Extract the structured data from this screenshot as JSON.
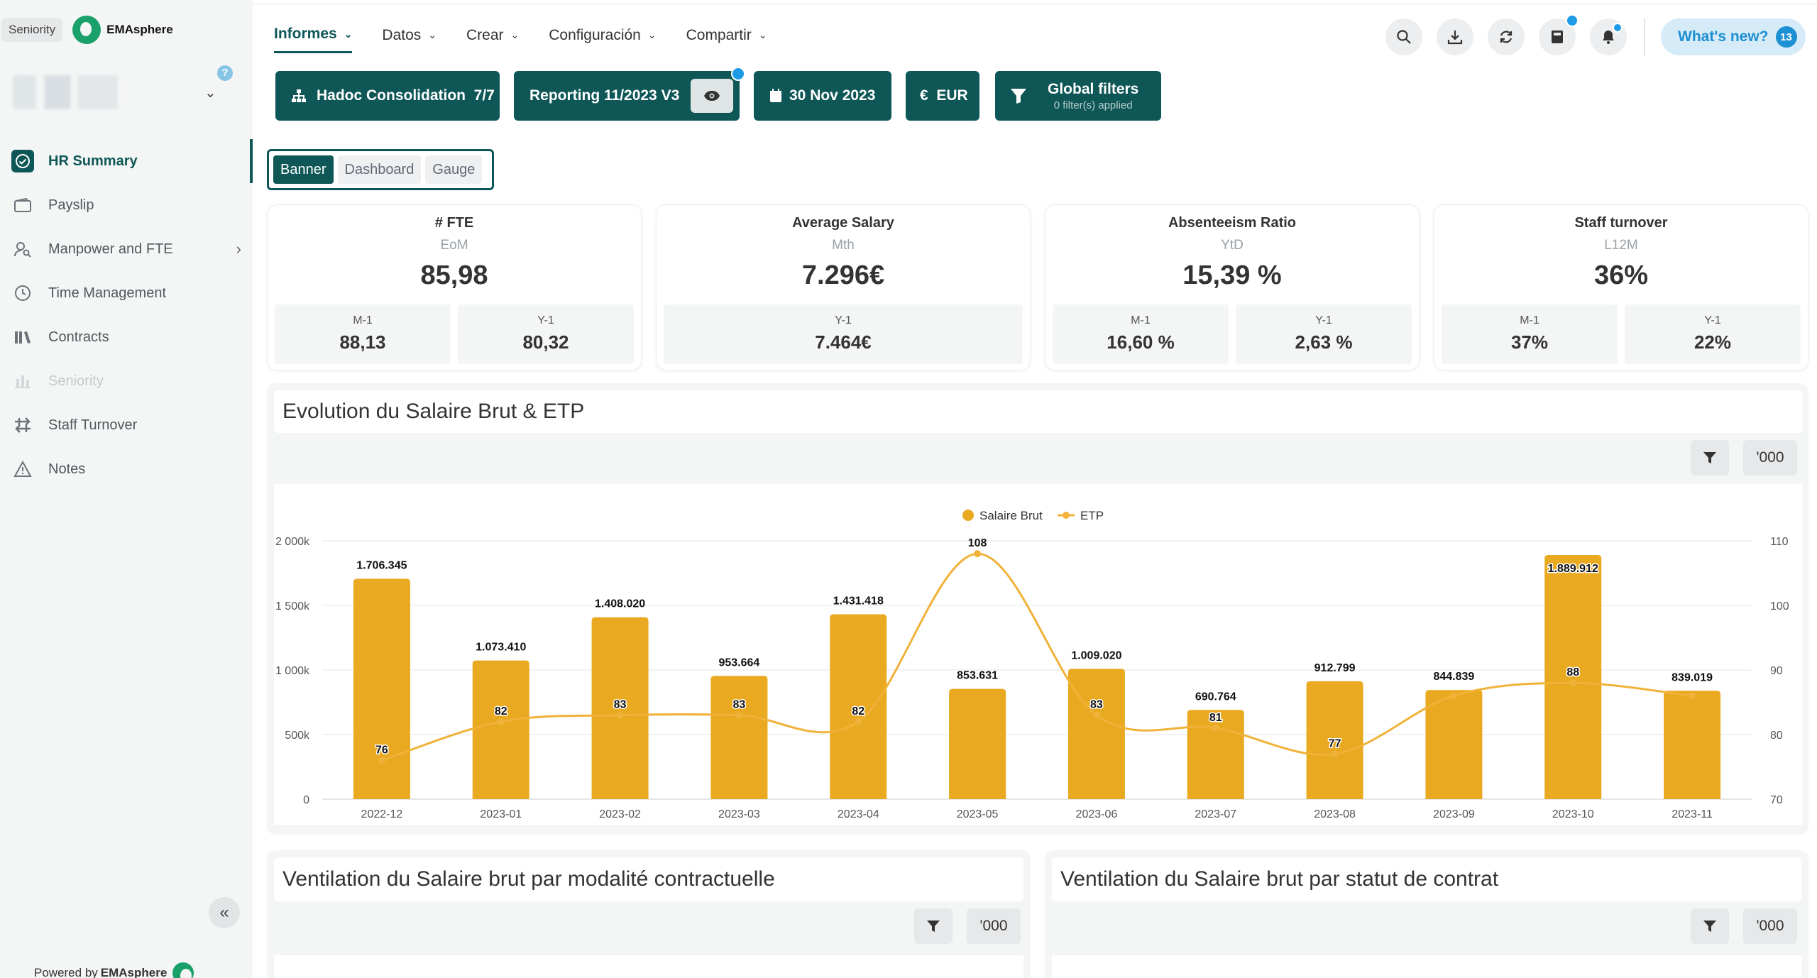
{
  "app": {
    "seniority_tag": "Seniority",
    "logo_text": "EMAsphere",
    "help": "?",
    "powered_prefix": "Powered by",
    "powered_brand": "EMAsphere"
  },
  "sidebar": {
    "items": [
      {
        "label": "HR Summary",
        "icon": "check-circle-icon",
        "active": true
      },
      {
        "label": "Payslip",
        "icon": "wallet-icon"
      },
      {
        "label": "Manpower and FTE",
        "icon": "person-search-icon",
        "has_arrow": true
      },
      {
        "label": "Time Management",
        "icon": "clock-icon"
      },
      {
        "label": "Contracts",
        "icon": "books-icon"
      },
      {
        "label": "Seniority",
        "icon": "bars-icon",
        "disabled": true
      },
      {
        "label": "Staff Turnover",
        "icon": "transfer-icon"
      },
      {
        "label": "Notes",
        "icon": "warning-icon"
      }
    ]
  },
  "menu": [
    {
      "label": "Informes",
      "active": true
    },
    {
      "label": "Datos"
    },
    {
      "label": "Crear"
    },
    {
      "label": "Configuración"
    },
    {
      "label": "Compartir"
    }
  ],
  "whats_new": {
    "label": "What's new?",
    "count": "13"
  },
  "toolbar": {
    "consolidation": "Hadoc Consolidation  7/7",
    "reporting": "Reporting 11/2023 V3",
    "date": "30 Nov 2023",
    "currency": "€  EUR",
    "global_filters": "Global filters",
    "filters_applied": "0 filter(s) applied"
  },
  "view_tabs": [
    "Banner",
    "Dashboard",
    "Gauge"
  ],
  "kpis": [
    {
      "title": "# FTE",
      "period": "EoM",
      "value": "85,98",
      "subs": [
        {
          "label": "M-1",
          "value": "88,13"
        },
        {
          "label": "Y-1",
          "value": "80,32"
        }
      ]
    },
    {
      "title": "Average Salary",
      "period": "Mth",
      "value": "7.296€",
      "subs": [
        {
          "label": "Y-1",
          "value": "7.464€"
        }
      ]
    },
    {
      "title": "Absenteeism Ratio",
      "period": "YtD",
      "value": "15,39 %",
      "subs": [
        {
          "label": "M-1",
          "value": "16,60 %"
        },
        {
          "label": "Y-1",
          "value": "2,63 %"
        }
      ]
    },
    {
      "title": "Staff turnover",
      "period": "L12M",
      "value": "36%",
      "subs": [
        {
          "label": "M-1",
          "value": "37%"
        },
        {
          "label": "Y-1",
          "value": "22%"
        }
      ]
    }
  ],
  "panels": {
    "main_title": "Evolution du Salaire Brut & ETP",
    "bottom_left_title": "Ventilation du Salaire brut par modalité contractuelle",
    "bottom_right_title": "Ventilation du Salaire brut par statut de contrat",
    "scale_label": "'000"
  },
  "chart_data": {
    "type": "bar",
    "categories": [
      "2022-12",
      "2023-01",
      "2023-02",
      "2023-03",
      "2023-04",
      "2023-05",
      "2023-06",
      "2023-07",
      "2023-08",
      "2023-09",
      "2023-10",
      "2023-11"
    ],
    "series": [
      {
        "name": "Salaire Brut",
        "type": "bar",
        "axis": "left",
        "color": "#e9a920",
        "values": [
          1706345,
          1073410,
          1408020,
          953664,
          1431418,
          853631,
          1009020,
          690764,
          912799,
          844839,
          1889912,
          839019
        ],
        "labels": [
          "1.706.345",
          "1.073.410",
          "1.408.020",
          "953.664",
          "1.431.418",
          "853.631",
          "1.009.020",
          "690.764",
          "912.799",
          "844.839",
          "1.889.912",
          "839.019"
        ]
      },
      {
        "name": "ETP",
        "type": "line",
        "axis": "right",
        "color": "#f0b238",
        "values": [
          76,
          82,
          83,
          83,
          82,
          108,
          83,
          81,
          77,
          86,
          88,
          86
        ],
        "labels": [
          "76",
          "82",
          "83",
          "83",
          "82",
          "108",
          "83",
          "81",
          "77",
          "",
          "88",
          ""
        ]
      }
    ],
    "y_left": {
      "min": 0,
      "max": 2000000,
      "ticks": [
        0,
        500000,
        1000000,
        1500000,
        2000000
      ],
      "tick_labels": [
        "0",
        "500k",
        "1 000k",
        "1 500k",
        "2 000k"
      ]
    },
    "y_right": {
      "min": 70,
      "max": 110,
      "ticks": [
        70,
        80,
        90,
        100,
        110
      ],
      "tick_labels": [
        "70",
        "80",
        "90",
        "100",
        "110"
      ]
    },
    "legend": "top-center",
    "grid": true
  }
}
